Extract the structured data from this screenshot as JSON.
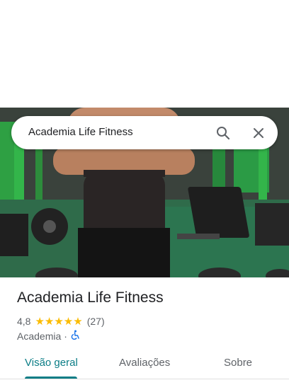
{
  "search": {
    "query": "Academia Life Fitness"
  },
  "place": {
    "name": "Academia Life Fitness",
    "rating": "4,8",
    "stars": "★★★★★",
    "review_count": "(27)",
    "category": "Academia",
    "separator": "·",
    "accessibility_icon": "wheelchair-icon"
  },
  "tabs": [
    {
      "label": "Visão geral",
      "active": true
    },
    {
      "label": "Avaliações",
      "active": false
    },
    {
      "label": "Sobre",
      "active": false
    }
  ],
  "colors": {
    "accent": "#0b7d86",
    "star": "#fbbc04",
    "access_icon": "#1a73e8"
  }
}
